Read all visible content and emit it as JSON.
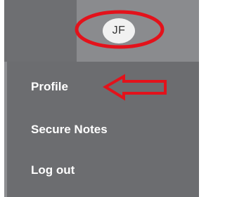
{
  "header": {
    "avatar_initials": "JF"
  },
  "menu": {
    "items": [
      {
        "label": "Profile"
      },
      {
        "label": "Secure Notes"
      },
      {
        "label": "Log out"
      }
    ]
  },
  "colors": {
    "annotation": "#e3121b",
    "menu_background": "#6c6d70",
    "header_background": "#8a8b8e",
    "menu_text": "#ffffff"
  },
  "icons": {
    "annotation_circle": "ellipse-highlight",
    "annotation_arrow": "left-arrow-outline"
  }
}
